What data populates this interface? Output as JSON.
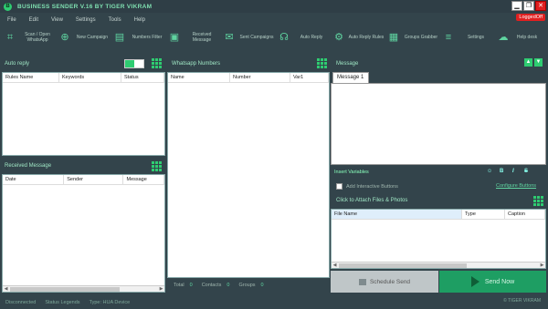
{
  "window": {
    "icon_letter": "B",
    "title": "BUSINESS SENDER V.16 BY TIGER VIKRAM",
    "min_label": "▁",
    "max_label": "❐",
    "close_label": "✕",
    "logged_status": "LoggedOff"
  },
  "menu": [
    "File",
    "Edit",
    "View",
    "Settings",
    "Tools",
    "Help"
  ],
  "toolbar": [
    {
      "label": "Scan / Open WhatsApp",
      "icon": "scan-icon",
      "glyph": "⌗"
    },
    {
      "label": "New Campaign",
      "icon": "plus-circle-icon",
      "glyph": "⊕"
    },
    {
      "label": "Numbers Filter",
      "icon": "numbers-filter-icon",
      "glyph": "▤"
    },
    {
      "label": "Received Message",
      "icon": "received-message-icon",
      "glyph": "▣"
    },
    {
      "label": "Sent Campaigns",
      "icon": "sent-campaigns-icon",
      "glyph": "✉"
    },
    {
      "label": "Auto Reply",
      "icon": "headset-icon",
      "glyph": "☊"
    },
    {
      "label": "Auto Reply Rules",
      "icon": "rules-icon",
      "glyph": "⚙"
    },
    {
      "label": "Groups Grabber",
      "icon": "groups-grabber-icon",
      "glyph": "▦"
    },
    {
      "label": "Settings",
      "icon": "settings-icon",
      "glyph": "≡"
    },
    {
      "label": "Help desk",
      "icon": "cloud-help-icon",
      "glyph": "☁"
    }
  ],
  "auto_reply": {
    "title": "Auto reply",
    "columns": [
      "Rules Name",
      "Keywords",
      "Status"
    ]
  },
  "whatsapp_numbers": {
    "title": "Whatsapp Numbers",
    "columns": [
      "Name",
      "Number",
      "Var1"
    ]
  },
  "message": {
    "title": "Message",
    "tab": "Message 1",
    "up": "▲",
    "down": "▼"
  },
  "received": {
    "title": "Received Message",
    "columns": [
      "Date",
      "Sender",
      "Message"
    ]
  },
  "editor": {
    "insert_variables": "Insert Variables",
    "emoji": "☺",
    "bold": "B",
    "italic": "I",
    "strike": "S",
    "interactive_label": "Add Interactive Buttons",
    "configure_link": "Configure Buttons"
  },
  "attach": {
    "title": "Click to Attach Files & Photos",
    "columns": [
      "File Name",
      "Type",
      "Caption"
    ]
  },
  "counts": {
    "total_label": "Total",
    "total": "0",
    "contacts_label": "Contacts",
    "contacts": "0",
    "groups_label": "Groups",
    "groups": "0"
  },
  "actions": {
    "schedule": "Schedule Send",
    "send": "Send Now"
  },
  "statusbar": {
    "connection": "Disconnected",
    "legend": "Status Legends",
    "type": "Type: HUA Device",
    "credit": "© TIGER VIKRAM"
  },
  "scroll": {
    "left": "◀",
    "right": "▶"
  },
  "colors": {
    "accent": "#2ecc71",
    "background": "#33444b",
    "send": "#1e9e63"
  }
}
